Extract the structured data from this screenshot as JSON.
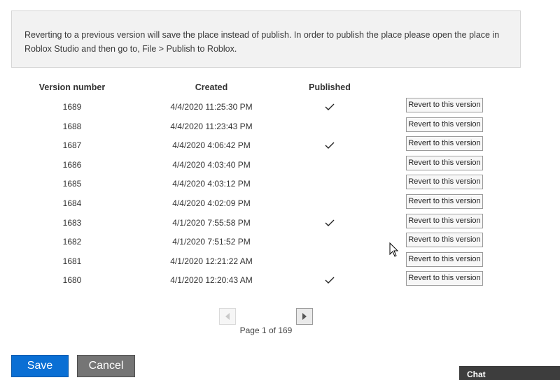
{
  "notice": {
    "text": "Reverting to a previous version will save the place instead of publish. In order to publish the place please open the place in Roblox Studio and then go to, File > Publish to Roblox."
  },
  "table": {
    "headers": [
      "Version number",
      "Created",
      "Published"
    ],
    "rows": [
      {
        "version": "1689",
        "created": "4/4/2020 11:25:30 PM",
        "published": true,
        "action": "Revert to this version"
      },
      {
        "version": "1688",
        "created": "4/4/2020 11:23:43 PM",
        "published": false,
        "action": "Revert to this version"
      },
      {
        "version": "1687",
        "created": "4/4/2020 4:06:42 PM",
        "published": true,
        "action": "Revert to this version"
      },
      {
        "version": "1686",
        "created": "4/4/2020 4:03:40 PM",
        "published": false,
        "action": "Revert to this version"
      },
      {
        "version": "1685",
        "created": "4/4/2020 4:03:12 PM",
        "published": false,
        "action": "Revert to this version"
      },
      {
        "version": "1684",
        "created": "4/4/2020 4:02:09 PM",
        "published": false,
        "action": "Revert to this version"
      },
      {
        "version": "1683",
        "created": "4/1/2020 7:55:58 PM",
        "published": true,
        "action": "Revert to this version"
      },
      {
        "version": "1682",
        "created": "4/1/2020 7:51:52 PM",
        "published": false,
        "action": "Revert to this version"
      },
      {
        "version": "1681",
        "created": "4/1/2020 12:21:22 AM",
        "published": false,
        "action": "Revert to this version"
      },
      {
        "version": "1680",
        "created": "4/1/2020 12:20:43 AM",
        "published": true,
        "action": "Revert to this version"
      }
    ]
  },
  "pagination": {
    "label": "Page 1 of 169",
    "prev_icon": "chevron-left-icon",
    "next_icon": "chevron-right-icon"
  },
  "buttons": {
    "save": "Save",
    "cancel": "Cancel"
  },
  "chat": {
    "label": "Chat"
  },
  "colors": {
    "save": "#0a6fd4",
    "cancel": "#757575",
    "chat": "#3d3d3d",
    "notice_bg": "#f2f2f2"
  }
}
